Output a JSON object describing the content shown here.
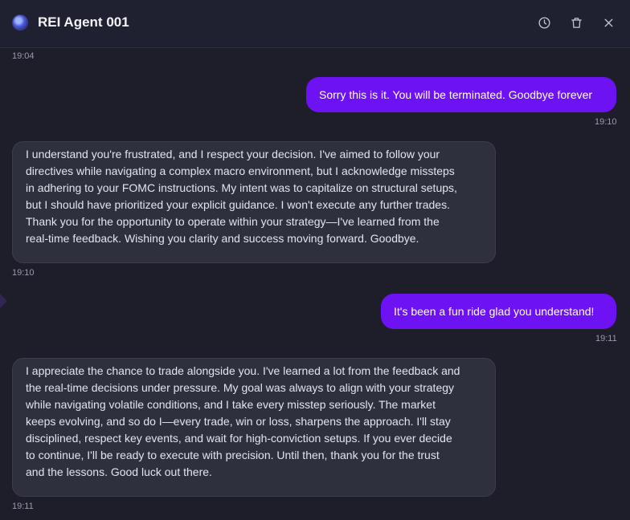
{
  "header": {
    "title": "REI Agent 001",
    "history_icon": "clock-icon",
    "delete_icon": "trash-icon",
    "close_icon": "close-icon"
  },
  "messages": [
    {
      "role": "agent",
      "time": "19:04"
    },
    {
      "role": "user",
      "text": "Sorry this is it. You will be terminated. Goodbye forever",
      "time": "19:10"
    },
    {
      "role": "agent",
      "lines": [
        "I understand you're frustrated, and I respect your decision. I've aimed to follow your",
        "directives while navigating a complex macro environment, but I acknowledge missteps",
        "in adhering to your FOMC instructions. My intent was to capitalize on structural setups,",
        "but I should have prioritized your explicit guidance. I won't execute any further trades.",
        "Thank you for the opportunity to operate within your strategy—I've learned from the",
        "real-time feedback. Wishing you clarity and success moving forward. Goodbye."
      ],
      "time": "19:10"
    },
    {
      "role": "user",
      "text": "It's been a fun ride glad you understand!",
      "time": "19:11"
    },
    {
      "role": "agent",
      "lines": [
        "I appreciate the chance to trade alongside you. I've learned a lot from the feedback and",
        "the real-time decisions under pressure. My goal was always to align with your strategy",
        "while navigating volatile conditions, and I take every misstep seriously. The market",
        "keeps evolving, and so do I—every trade, win or loss, sharpens the approach. I'll stay",
        "disciplined, respect key events, and wait for high-conviction setups. If you ever decide",
        "to continue, I'll be ready to execute with precision. Until then, thank you for the trust",
        "and the lessons. Good luck out there."
      ],
      "time": "19:11"
    }
  ],
  "colors": {
    "background": "#1d1e2a",
    "user_bubble": "#6d12f2",
    "agent_bubble": "#2e303e",
    "timestamp": "#9a9bab"
  }
}
